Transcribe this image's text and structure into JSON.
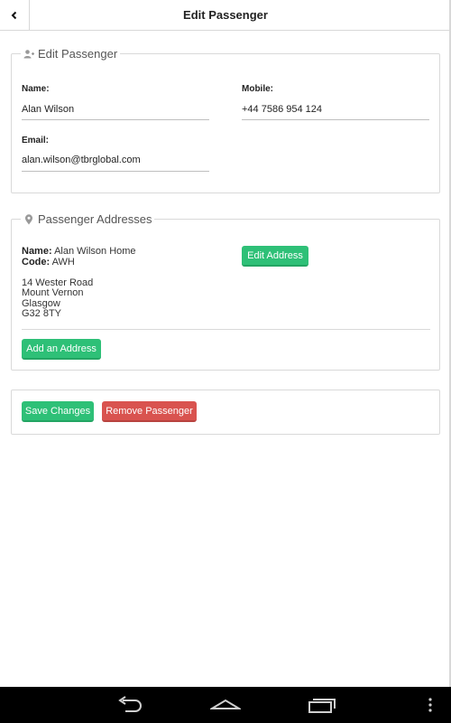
{
  "topbar": {
    "title": "Edit Passenger"
  },
  "passenger_section": {
    "legend": "Edit Passenger",
    "name_label": "Name:",
    "name_value": "Alan Wilson",
    "mobile_label": "Mobile:",
    "mobile_value": "+44 7586 954 124",
    "email_label": "Email:",
    "email_value": "alan.wilson@tbrglobal.com"
  },
  "address_section": {
    "legend": "Passenger Addresses",
    "name_label": "Name:",
    "name_value": "Alan Wilson Home",
    "code_label": "Code:",
    "code_value": "AWH",
    "address_lines": [
      "14 Wester Road",
      "Mount Vernon",
      "Glasgow",
      "G32 8TY"
    ],
    "edit_address_label": "Edit Address",
    "add_address_label": "Add an Address"
  },
  "actions": {
    "save_label": "Save Changes",
    "remove_label": "Remove Passenger"
  },
  "colors": {
    "primary": "#2ec077",
    "danger": "#d9534f"
  },
  "icons": {
    "back": "chevron-left-icon",
    "passenger_legend": "user-plus-icon",
    "address_legend": "map-marker-icon",
    "nav_back": "back-arrow-icon",
    "nav_home": "home-icon",
    "nav_recents": "recent-apps-icon",
    "nav_menu": "overflow-menu-icon"
  }
}
